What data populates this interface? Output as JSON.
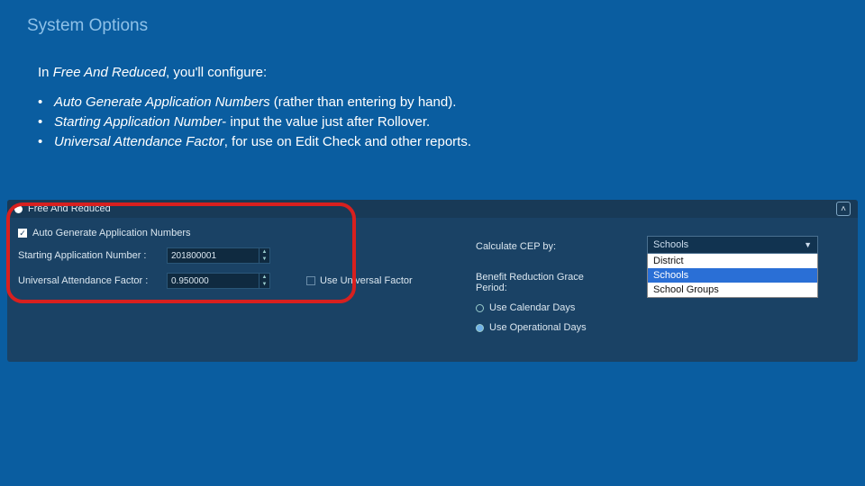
{
  "title": "System Options",
  "intro": {
    "prefix": "In ",
    "section": "Free And Reduced",
    "suffix": ", you'll configure:"
  },
  "bullets": [
    {
      "em": "Auto Generate Application Numbers",
      "rest": " (rather than entering by hand)."
    },
    {
      "em": "Starting Application Number",
      "rest": "- input the value just after Rollover."
    },
    {
      "em": "Universal Attendance Factor",
      "rest": ", for use on Edit Check and other reports."
    }
  ],
  "panel": {
    "header": "Free And Reduced",
    "autoGen": "Auto Generate Application Numbers",
    "startLbl": "Starting Application Number :",
    "startVal": "201800001",
    "uafLbl": "Universal Attendance Factor :",
    "uafVal": "0.950000",
    "useUF": "Use Universal Factor",
    "calcLbl": "Calculate CEP by:",
    "benefitLbl": "Benefit Reduction Grace Period:",
    "optCal": "Use Calendar Days",
    "optOp": "Use Operational Days"
  },
  "dropdown": {
    "selected": "Schools",
    "options": [
      "District",
      "Schools",
      "School Groups"
    ]
  }
}
